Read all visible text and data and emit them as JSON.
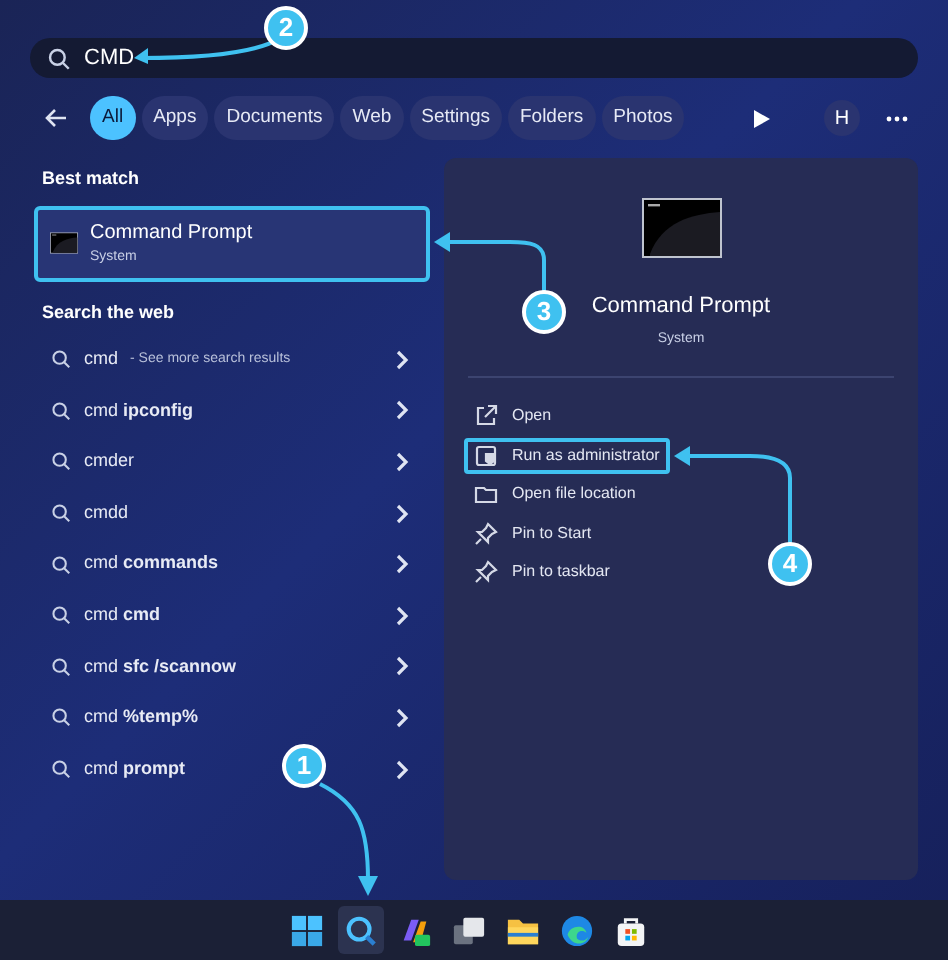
{
  "search": {
    "value": "CMD"
  },
  "filters": [
    {
      "label": "All",
      "selected": true
    },
    {
      "label": "Apps",
      "selected": false
    },
    {
      "label": "Documents",
      "selected": false
    },
    {
      "label": "Web",
      "selected": false
    },
    {
      "label": "Settings",
      "selected": false
    },
    {
      "label": "Folders",
      "selected": false
    },
    {
      "label": "Photos",
      "selected": false
    }
  ],
  "account_initial": "H",
  "best_match": {
    "heading": "Best match",
    "title": "Command Prompt",
    "subtitle": "System",
    "highlighted": true
  },
  "web": {
    "heading": "Search the web",
    "items": [
      {
        "text": "cmd",
        "hint": "- See more search results"
      },
      {
        "text": "cmd **ipconfig**"
      },
      {
        "text": "cmder"
      },
      {
        "text": "cmdd"
      },
      {
        "text": "cmd **commands**"
      },
      {
        "text": "cmd **cmd**"
      },
      {
        "text": "cmd **sfc /scannow**"
      },
      {
        "text": "cmd **%temp%**"
      },
      {
        "text": "cmd **prompt**"
      }
    ]
  },
  "details": {
    "title": "Command Prompt",
    "subtitle": "System",
    "actions": [
      {
        "kind": "open",
        "label": "Open",
        "highlighted": false
      },
      {
        "kind": "admin",
        "label": "Run as administrator",
        "highlighted": true
      },
      {
        "kind": "folder",
        "label": "Open file location",
        "highlighted": false
      },
      {
        "kind": "pin",
        "label": "Pin to Start",
        "highlighted": false
      },
      {
        "kind": "pin",
        "label": "Pin to taskbar",
        "highlighted": false
      }
    ]
  },
  "taskbar": [
    {
      "kind": "start",
      "selected": false
    },
    {
      "kind": "search",
      "selected": true
    },
    {
      "kind": "copilot",
      "selected": false
    },
    {
      "kind": "taskview",
      "selected": false
    },
    {
      "kind": "explorer",
      "selected": false
    },
    {
      "kind": "edge",
      "selected": false
    },
    {
      "kind": "store",
      "selected": false
    }
  ],
  "callouts": [
    {
      "label": "2"
    },
    {
      "label": "3"
    },
    {
      "label": "4"
    },
    {
      "label": "1"
    }
  ]
}
